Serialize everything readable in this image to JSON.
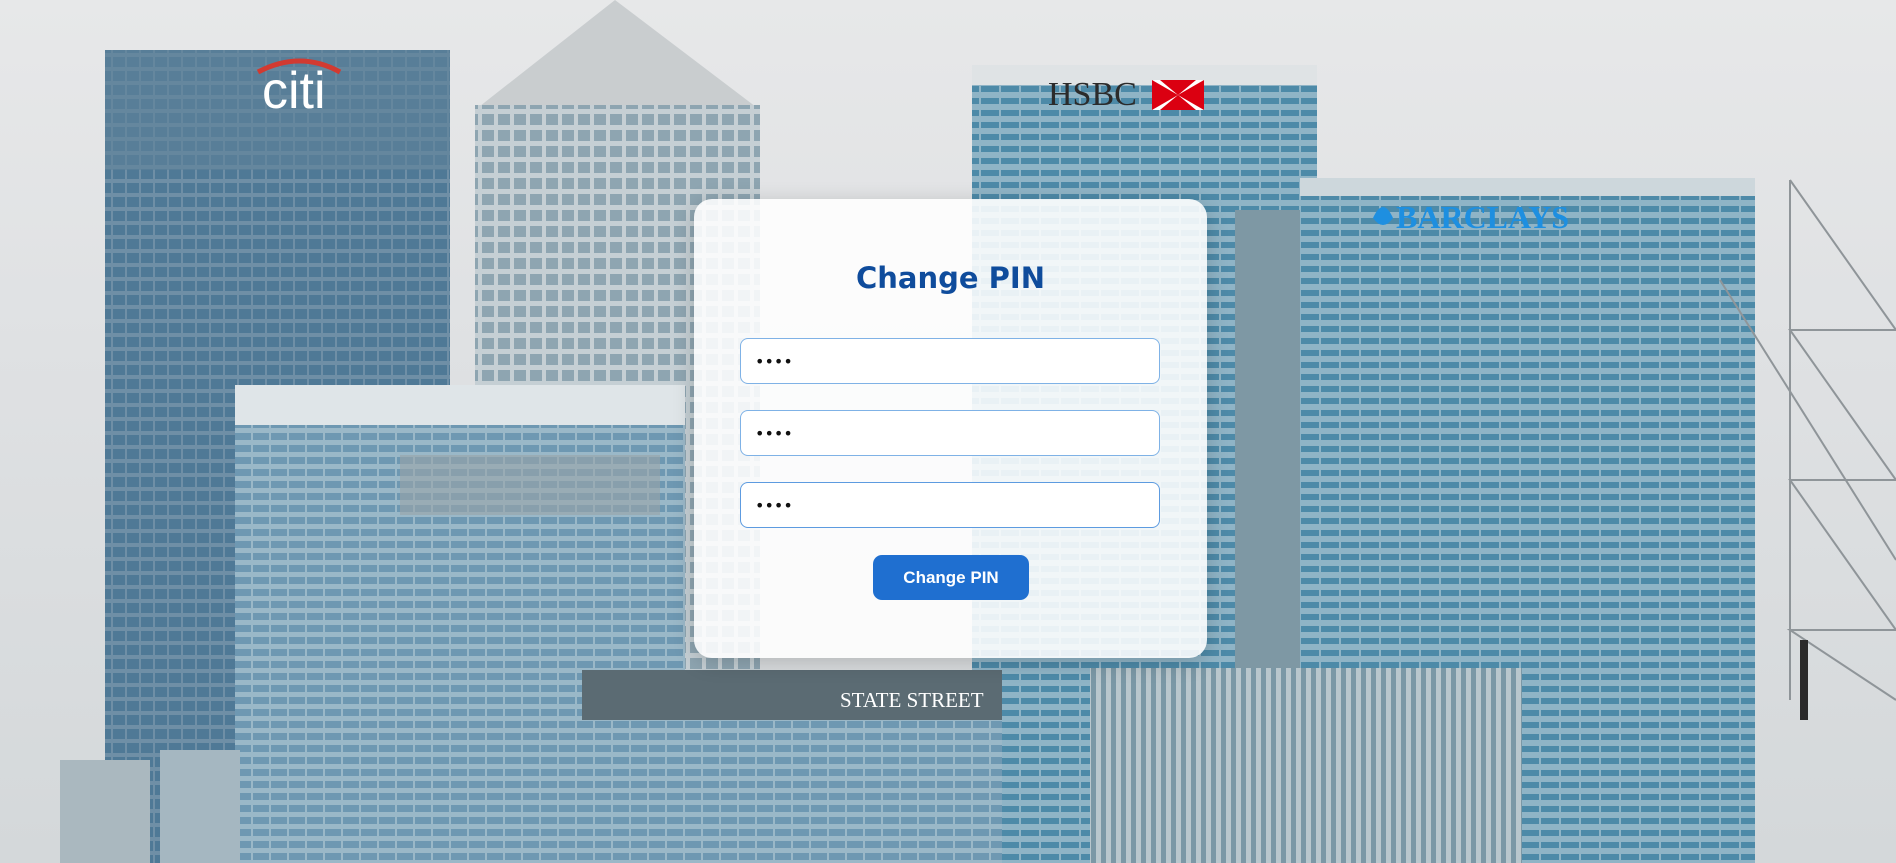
{
  "background": {
    "signs": {
      "citi": "citi",
      "hsbc": "HSBC",
      "barclays": "BARCLAYS",
      "state_street": "STATE STREET"
    }
  },
  "form": {
    "title": "Change PIN",
    "fields": [
      {
        "value": "1234",
        "masked": "••••"
      },
      {
        "value": "1234",
        "masked": "••••"
      },
      {
        "value": "1234",
        "masked": "••••"
      }
    ],
    "submit_label": "Change PIN"
  },
  "colors": {
    "title": "#0f4c9c",
    "button": "#1f6fd0",
    "field_border": "#7fb2e6"
  }
}
